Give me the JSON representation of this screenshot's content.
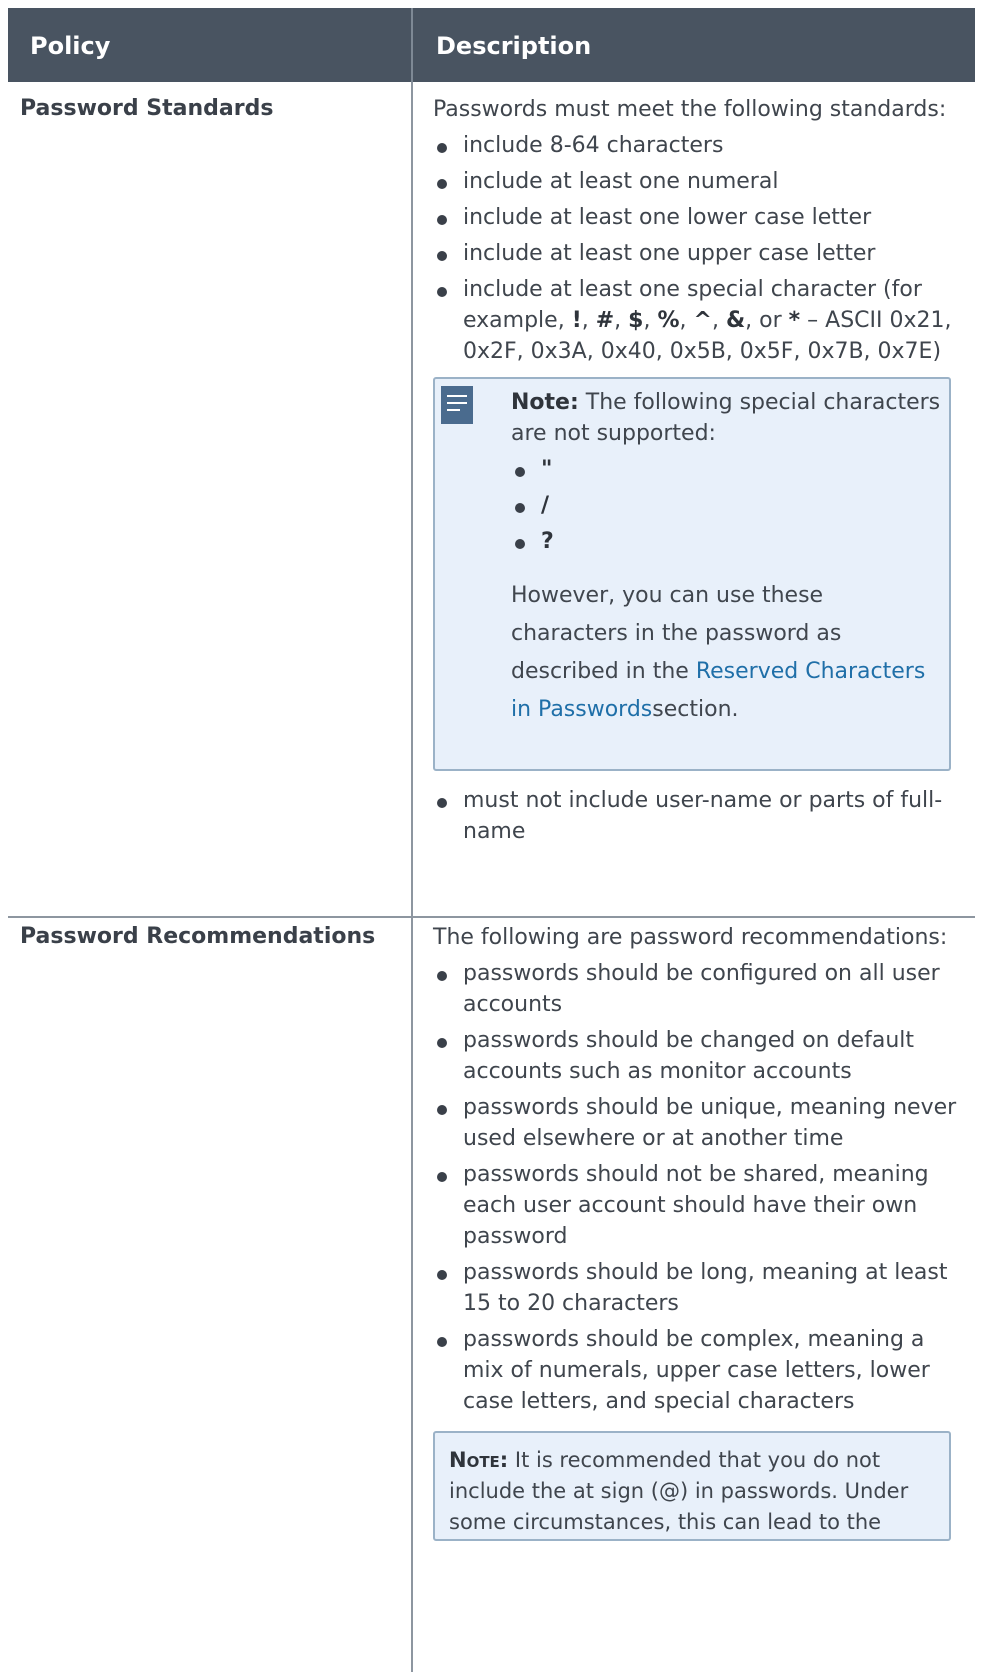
{
  "header": {
    "col1": "Policy",
    "col2": "Description"
  },
  "standards": {
    "title": "Password Standards",
    "intro": "Passwords must meet the following standards:",
    "items": [
      "include 8-64 characters",
      "include at least one numeral",
      "include at least one lower case letter",
      "include at least one upper case letter"
    ],
    "special": {
      "prefix": "include at least one special character (for example, ",
      "chars": [
        "!",
        "#",
        "$",
        "%",
        "^",
        "&",
        "*"
      ],
      "suffix": " – ASCII 0x21, 0x2F, 0x3A, 0x40, 0x5B, 0x5F, 0x7B, 0x7E)"
    },
    "note": {
      "label": "Note:",
      "text": " The following special characters are not supported:",
      "chars": [
        "\"",
        "/",
        "?"
      ],
      "after_prefix": "However, you can use these characters in the password as described in the ",
      "link": "Reserved Characters in Passwords",
      "after_suffix": "section."
    },
    "last_item": "must not include user-name or parts of full-name"
  },
  "recommendations": {
    "title": "Password Recommendations",
    "intro": "The following are password recommendations:",
    "items": [
      "passwords should be configured on all user accounts",
      "passwords should be changed on default accounts such as monitor accounts",
      "passwords should be unique, meaning never used elsewhere or at another time",
      "passwords should not be shared, meaning each user account should have their own password",
      "passwords should be long, meaning at least 15 to 20 characters",
      "passwords should be complex, meaning a mix of numerals, upper case letters, lower case letters, and special characters"
    ],
    "note": {
      "label": "Note:",
      "text": " It is recommended that you do not include the at sign (@) in passwords. Under some circumstances, this can lead to the"
    }
  }
}
